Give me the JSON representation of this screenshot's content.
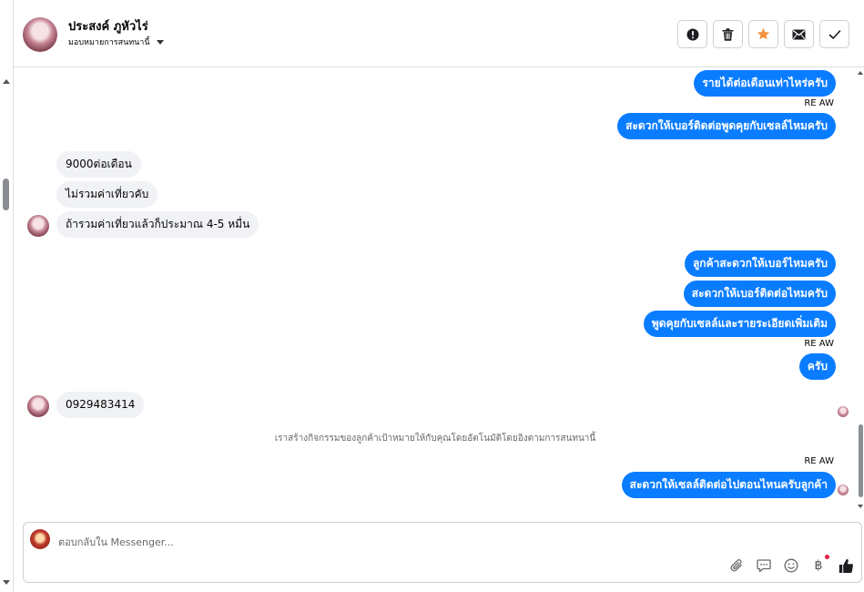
{
  "header": {
    "contact_name": "ประสงค์ ภูหัวไร่",
    "assign_label": "มอบหมายการสนทนานี้",
    "actions": [
      {
        "name": "report-button",
        "icon": "exclamation-icon"
      },
      {
        "name": "delete-button",
        "icon": "trash-icon"
      },
      {
        "name": "star-button",
        "icon": "star-icon"
      },
      {
        "name": "mark-unread-button",
        "icon": "envelope-icon"
      },
      {
        "name": "mark-done-button",
        "icon": "check-icon"
      }
    ],
    "star_color": "#f7923b"
  },
  "messages": {
    "out1": "รายได้ต่อเดือนเท่าไหร่ครับ",
    "tag1": "RE AW",
    "out2": "สะดวกให้เบอร์ติดต่อพูดคุยกับเซลล์ไหมครับ",
    "in1": "9000ต่อเดือน",
    "in2": "ไม่รวมค่าเที่ยวคับ",
    "in3": "ถ้ารวมค่าเที่ยวแล้วก็ประมาณ 4-5 หมื่น",
    "out3": "ลูกค้าสะดวกให้เบอร์ไหมครับ",
    "out4": "สะดวกให้เบอร์ติดต่อไหมครับ",
    "out5": "พูดคุยกับเซลล์และรายระเอียดเพิ่มเติม",
    "tag2": "RE AW",
    "out6": "ครับ",
    "in4": "0929483414",
    "system_note": "เราสร้างกิจกรรมของลูกค้าเป้าหมายให้กับคุณโดยอัตโนมัติโดยอิงตามการสนทนานี้",
    "tag3": "RE AW",
    "out7": "สะดวกให้เซลล์ติดต่อไปตอนไหนครับลูกค้า"
  },
  "composer": {
    "placeholder": "ตอบกลับใน Messenger...",
    "tools": [
      "attach-icon",
      "saved-replies-icon",
      "emoji-icon",
      "payment-icon",
      "like-icon"
    ],
    "payment_symbol": "฿"
  },
  "colors": {
    "outgoing_bubble": "#0a7cff",
    "incoming_bubble": "#f0f2f5"
  }
}
